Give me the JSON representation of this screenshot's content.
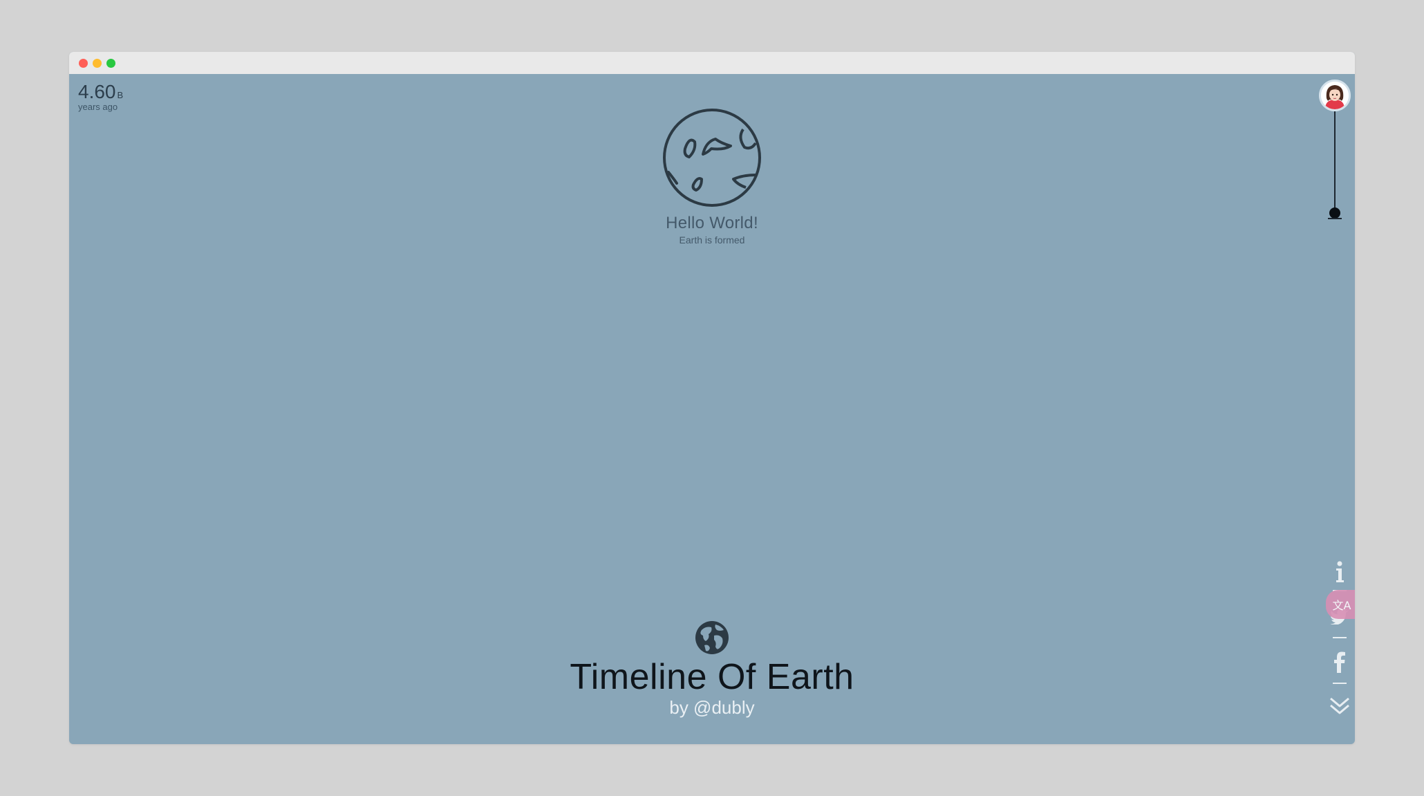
{
  "window": {
    "controls": [
      "close",
      "minimize",
      "maximize"
    ]
  },
  "age": {
    "value": "4.60",
    "unit": "B",
    "label": "years ago"
  },
  "event": {
    "icon": "earth-outline-icon",
    "title": "Hello World!",
    "subtitle": "Earth is formed"
  },
  "timeline": {
    "avatar": "avatar-girl-icon",
    "position": 1.0
  },
  "social": [
    {
      "name": "info",
      "icon": "info-icon"
    },
    {
      "name": "twitter",
      "icon": "twitter-icon"
    },
    {
      "name": "facebook",
      "icon": "facebook-icon"
    },
    {
      "name": "scroll-down",
      "icon": "double-chevron-down-icon"
    }
  ],
  "translate": {
    "label": "文A"
  },
  "footer": {
    "icon": "globe-filled-icon",
    "title": "Timeline Of Earth",
    "byline": "by @dubly"
  },
  "colors": {
    "background": "#89a6b8",
    "titlebar": "#e9e9e9",
    "accent": "#d88fb4",
    "text_dark": "#0f151b"
  }
}
